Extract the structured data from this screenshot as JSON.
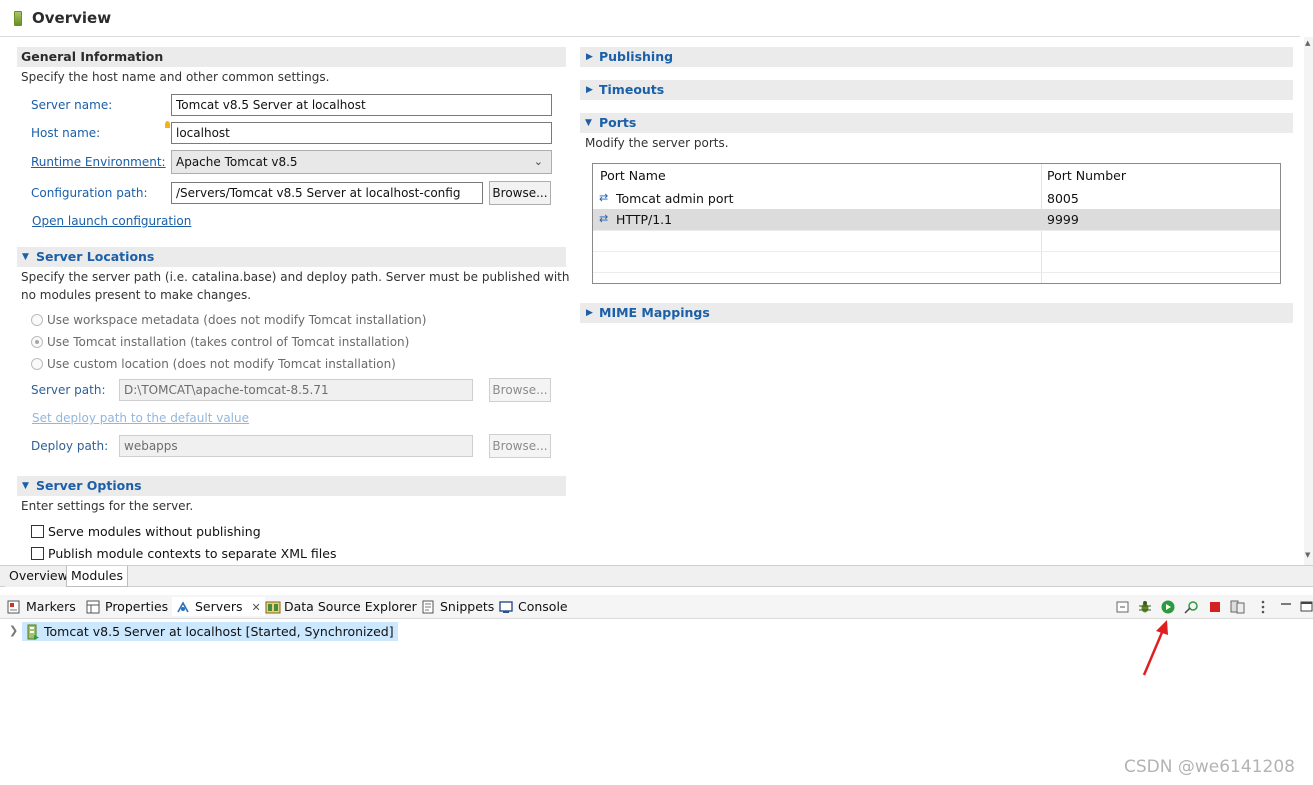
{
  "editor": {
    "title": "Overview",
    "general": {
      "heading": "General Information",
      "description": "Specify the host name and other common settings.",
      "server_name_label": "Server name:",
      "server_name_value": "Tomcat v8.5 Server at localhost",
      "host_name_label": "Host name:",
      "host_name_value": "localhost",
      "runtime_label": "Runtime Environment:",
      "runtime_value": "Apache Tomcat v8.5",
      "config_path_label": "Configuration path:",
      "config_path_value": "/Servers/Tomcat v8.5 Server at localhost-config",
      "browse_label": "Browse...",
      "open_launch_link": "Open launch configuration"
    },
    "server_locations": {
      "heading": "Server Locations",
      "description_line1": "Specify the server path (i.e. catalina.base) and deploy path. Server must be published with",
      "description_line2": "no modules present to make changes.",
      "options": [
        {
          "label": "Use workspace metadata (does not modify Tomcat installation)",
          "checked": false
        },
        {
          "label": "Use Tomcat installation (takes control of Tomcat installation)",
          "checked": true
        },
        {
          "label": "Use custom location (does not modify Tomcat installation)",
          "checked": false
        }
      ],
      "server_path_label": "Server path:",
      "server_path_value": "D:\\TOMCAT\\apache-tomcat-8.5.71",
      "set_deploy_link": "Set deploy path to the default value",
      "deploy_path_label": "Deploy path:",
      "deploy_path_value": "webapps",
      "browse_label": "Browse..."
    },
    "server_options": {
      "heading": "Server Options",
      "description": "Enter settings for the server.",
      "checkboxes": [
        {
          "label": "Serve modules without publishing",
          "checked": false
        },
        {
          "label": "Publish module contexts to separate XML files",
          "checked": false
        }
      ]
    },
    "right": {
      "publishing": "Publishing",
      "timeouts": "Timeouts",
      "ports": "Ports",
      "ports_description": "Modify the server ports.",
      "ports_columns": [
        "Port Name",
        "Port Number"
      ],
      "ports_rows": [
        {
          "name": "Tomcat admin port",
          "number": "8005"
        },
        {
          "name": "HTTP/1.1",
          "number": "9999"
        }
      ],
      "mime": "MIME Mappings"
    },
    "tabs": [
      "Overview",
      "Modules"
    ]
  },
  "views": {
    "tabs": [
      {
        "label": "Markers",
        "icon": "markers-icon"
      },
      {
        "label": "Properties",
        "icon": "properties-icon"
      },
      {
        "label": "Servers",
        "icon": "servers-icon",
        "active": true
      },
      {
        "label": "Data Source Explorer",
        "icon": "data-source-icon"
      },
      {
        "label": "Snippets",
        "icon": "snippets-icon"
      },
      {
        "label": "Console",
        "icon": "console-icon"
      }
    ],
    "close_glyph": "✕",
    "server_entry": "Tomcat v8.5 Server at localhost  [Started, Synchronized]"
  },
  "watermark": "CSDN @we6141208",
  "colors": {
    "section_blue": "#1a5fa8",
    "selection": "#cce8ff",
    "arrow_red": "#e02020"
  }
}
